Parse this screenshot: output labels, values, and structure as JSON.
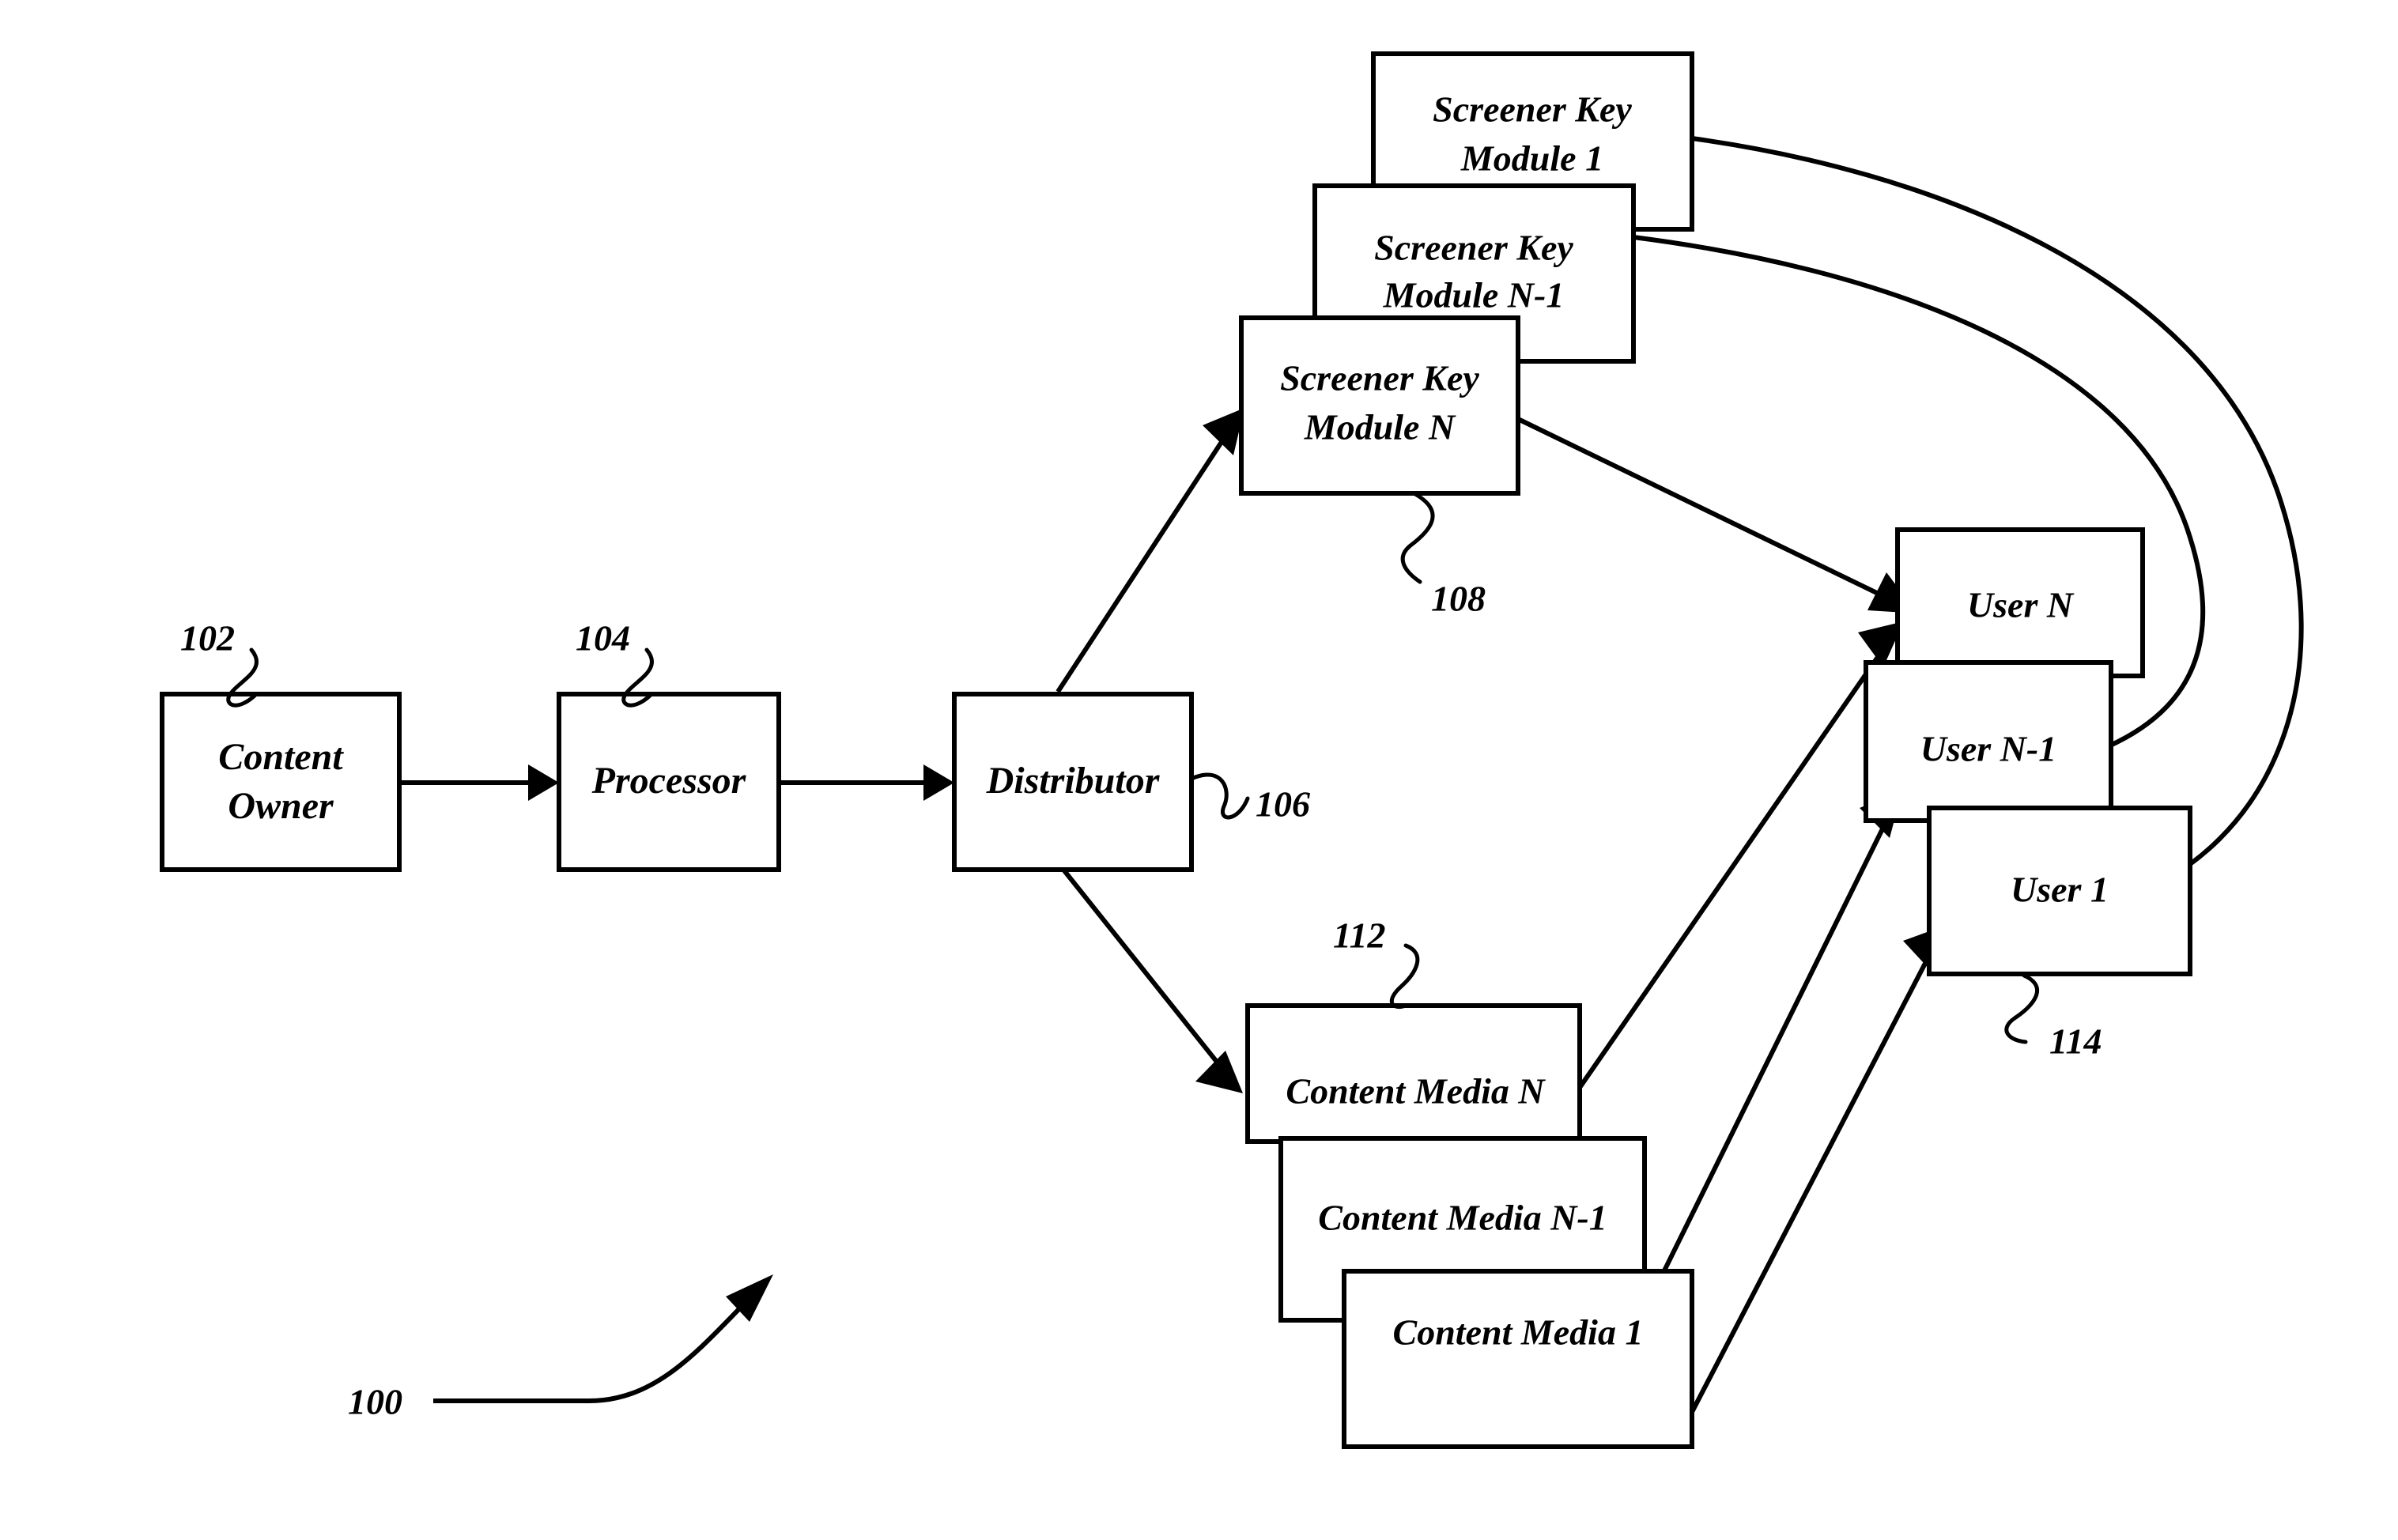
{
  "figure": {
    "kind": "patent-block-diagram",
    "reference_numeral": "100",
    "background_color": "#ffffff",
    "line_color": "#000000"
  },
  "blocks": {
    "content_owner": {
      "label_line1": "Content",
      "label_line2": "Owner",
      "ref": "102"
    },
    "processor": {
      "label": "Processor",
      "ref": "104"
    },
    "distributor": {
      "label": "Distributor",
      "ref": "106"
    },
    "screener_key_modules": {
      "ref": "108",
      "items": [
        {
          "label_line1": "Screener Key",
          "label_line2": "Module 1"
        },
        {
          "label_line1": "Screener Key",
          "label_line2": "Module N-1"
        },
        {
          "label_line1": "Screener Key",
          "label_line2": "Module N"
        }
      ]
    },
    "content_media": {
      "ref": "112",
      "items": [
        {
          "label": "Content Media N"
        },
        {
          "label": "Content Media N-1"
        },
        {
          "label": "Content Media  1"
        }
      ]
    },
    "users": {
      "ref": "114",
      "items": [
        {
          "label": "User N"
        },
        {
          "label": "User N-1"
        },
        {
          "label": "User 1"
        }
      ]
    }
  },
  "connections": [
    {
      "from": "Content Owner",
      "to": "Processor"
    },
    {
      "from": "Processor",
      "to": "Distributor"
    },
    {
      "from": "Distributor",
      "to": "Screener Key Module N"
    },
    {
      "from": "Distributor",
      "to": "Content Media N"
    },
    {
      "from": "Screener Key Module N",
      "to": "User N"
    },
    {
      "from": "Screener Key Module N-1",
      "to": "User N-1"
    },
    {
      "from": "Screener Key Module 1",
      "to": "User 1"
    },
    {
      "from": "Content Media N",
      "to": "User N"
    },
    {
      "from": "Content Media N-1",
      "to": "User N-1"
    },
    {
      "from": "Content Media  1",
      "to": "User 1"
    }
  ]
}
